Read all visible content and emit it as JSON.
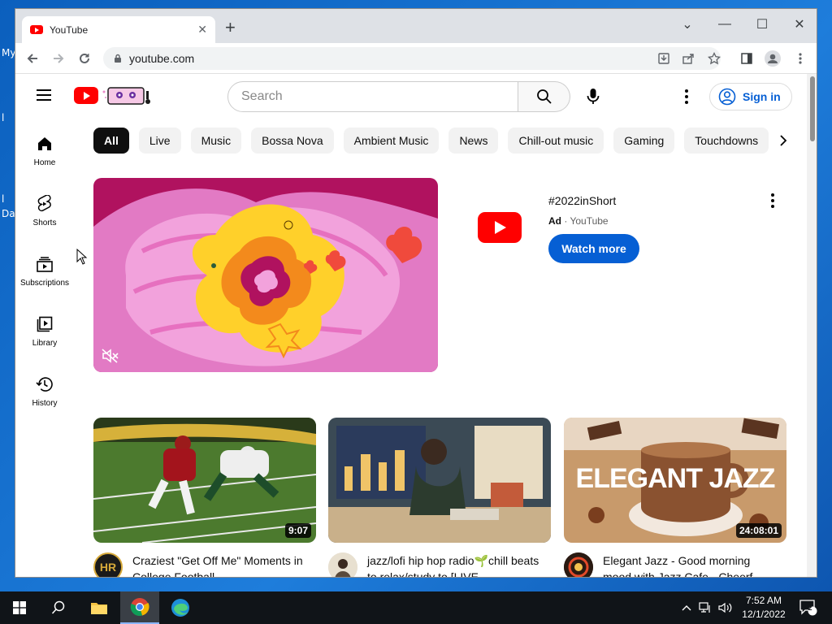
{
  "desktop": {
    "fragments": [
      "My",
      "l",
      "l",
      "Da"
    ]
  },
  "browser": {
    "tab_title": "YouTube",
    "tab_close": "✕",
    "new_tab": "+",
    "url": "youtube.com",
    "controls": {
      "dropdown": "⌄",
      "minimize": "—",
      "maximize": "☐",
      "close": "✕"
    }
  },
  "youtube": {
    "search_placeholder": "Search",
    "sign_in": "Sign in",
    "guide": [
      {
        "label": "Home",
        "icon": "home-icon"
      },
      {
        "label": "Shorts",
        "icon": "shorts-icon"
      },
      {
        "label": "Subscriptions",
        "icon": "subscriptions-icon"
      },
      {
        "label": "Library",
        "icon": "library-icon"
      },
      {
        "label": "History",
        "icon": "history-icon"
      }
    ],
    "chips": [
      "All",
      "Live",
      "Music",
      "Bossa Nova",
      "Ambient Music",
      "News",
      "Chill-out music",
      "Gaming",
      "Touchdowns"
    ],
    "ad": {
      "title": "#2022inShort",
      "badge": "Ad",
      "separator": " · ",
      "channel": "YouTube",
      "cta": "Watch more"
    },
    "videos": [
      {
        "title": "Craziest \"Get Off Me\" Moments in College Football",
        "duration": "9:07",
        "avatar_text": "HR"
      },
      {
        "title": "jazz/lofi hip hop radio🌱chill beats to relax/study to [LIVE",
        "duration": "",
        "avatar_text": ""
      },
      {
        "title": "Elegant Jazz - Good morning mood with Jazz Cafe - Cheerf",
        "duration": "24:08:01",
        "avatar_text": "",
        "thumb_text": "ELEGANT JAZZ"
      }
    ]
  },
  "taskbar": {
    "time": "7:52 AM",
    "date": "12/1/2022",
    "notification_count": "2"
  },
  "colors": {
    "youtube_red": "#ff0000",
    "link_blue": "#065fd4",
    "chip_bg": "#f2f2f2"
  }
}
